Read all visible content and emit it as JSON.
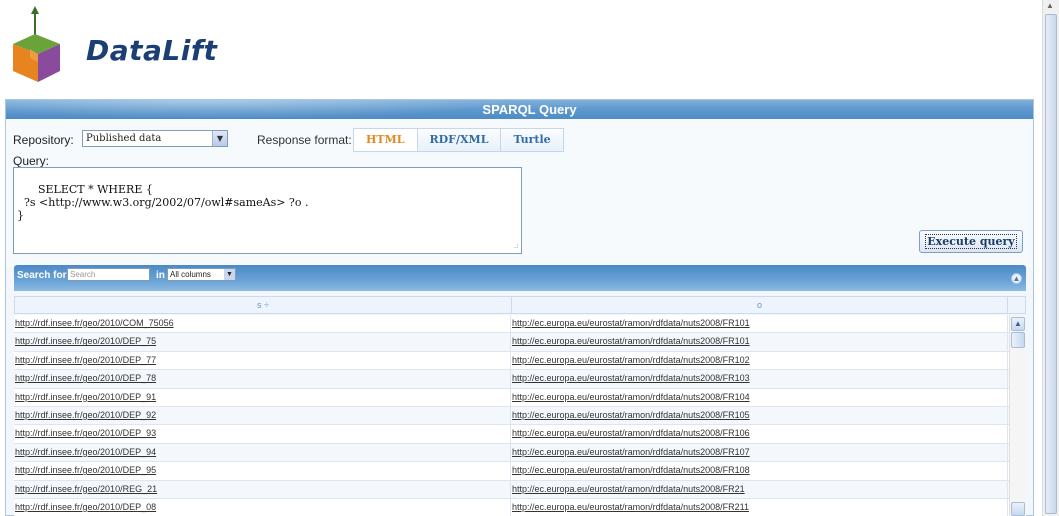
{
  "brand": {
    "name": "DataLift"
  },
  "panel": {
    "title": "SPARQL Query"
  },
  "form": {
    "repository_label": "Repository:",
    "repository_value": "Published data",
    "response_format_label": "Response format:",
    "formats": [
      "HTML",
      "RDF/XML",
      "Turtle"
    ],
    "selected_format": "HTML",
    "query_label": "Query:",
    "query_text": "SELECT * WHERE {\n  ?s <http://www.w3.org/2002/07/owl#sameAs> ?o .\n}",
    "execute_label": "Execute query"
  },
  "grid": {
    "search_label": "Search for",
    "search_placeholder": "Search",
    "in_label": "in",
    "columns_select_value": "All columns",
    "columns": [
      "s ÷",
      "o"
    ],
    "sorted_column": "s",
    "rows": [
      [
        "http://rdf.insee.fr/geo/2010/COM_75056",
        "http://ec.europa.eu/eurostat/ramon/rdfdata/nuts2008/FR101"
      ],
      [
        "http://rdf.insee.fr/geo/2010/DEP_75",
        "http://ec.europa.eu/eurostat/ramon/rdfdata/nuts2008/FR101"
      ],
      [
        "http://rdf.insee.fr/geo/2010/DEP_77",
        "http://ec.europa.eu/eurostat/ramon/rdfdata/nuts2008/FR102"
      ],
      [
        "http://rdf.insee.fr/geo/2010/DEP_78",
        "http://ec.europa.eu/eurostat/ramon/rdfdata/nuts2008/FR103"
      ],
      [
        "http://rdf.insee.fr/geo/2010/DEP_91",
        "http://ec.europa.eu/eurostat/ramon/rdfdata/nuts2008/FR104"
      ],
      [
        "http://rdf.insee.fr/geo/2010/DEP_92",
        "http://ec.europa.eu/eurostat/ramon/rdfdata/nuts2008/FR105"
      ],
      [
        "http://rdf.insee.fr/geo/2010/DEP_93",
        "http://ec.europa.eu/eurostat/ramon/rdfdata/nuts2008/FR106"
      ],
      [
        "http://rdf.insee.fr/geo/2010/DEP_94",
        "http://ec.europa.eu/eurostat/ramon/rdfdata/nuts2008/FR107"
      ],
      [
        "http://rdf.insee.fr/geo/2010/DEP_95",
        "http://ec.europa.eu/eurostat/ramon/rdfdata/nuts2008/FR108"
      ],
      [
        "http://rdf.insee.fr/geo/2010/REG_21",
        "http://ec.europa.eu/eurostat/ramon/rdfdata/nuts2008/FR21"
      ],
      [
        "http://rdf.insee.fr/geo/2010/DEP_08",
        "http://ec.europa.eu/eurostat/ramon/rdfdata/nuts2008/FR211"
      ]
    ]
  },
  "icons": {
    "logo": "datalift-cube-logo",
    "select_arrow": "chevron-down-icon",
    "collapse": "collapse-circle-icon",
    "scroll_up": "chevron-up-icon"
  },
  "colors": {
    "brand_blue": "#1b3f75",
    "header_blue": "#5f98cd",
    "active_format": "#e2891f",
    "format_link": "#2f6ca8"
  }
}
